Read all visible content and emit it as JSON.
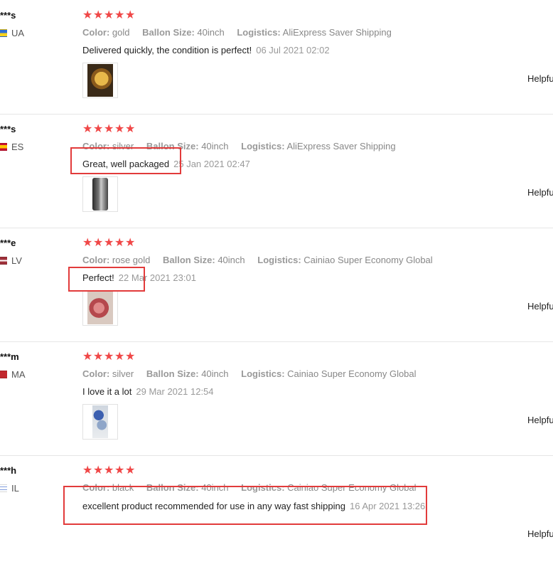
{
  "labels": {
    "color": "Color:",
    "balloon_size": "Ballon Size:",
    "logistics": "Logistics:",
    "helpful": "Helpfu"
  },
  "rating_star": "★",
  "colors": {
    "star": "#f04747",
    "highlight_box": "#e23b3b"
  },
  "reviews": [
    {
      "user": "***s",
      "country": "UA",
      "flag": [
        "#2f6fd6",
        "#f7d21c"
      ],
      "rating": 5,
      "color": "gold",
      "size": "40inch",
      "logistics": "AliExpress Saver Shipping",
      "comment": "Delivered quickly, the condition is perfect!",
      "date": "06 Jul 2021 02:02",
      "photo_icon": "photo-gold-balloon-icon"
    },
    {
      "user": "***s",
      "country": "ES",
      "flag": [
        "#c8102e",
        "#ffc400",
        "#c8102e"
      ],
      "rating": 5,
      "color": "silver",
      "size": "40inch",
      "logistics": "AliExpress Saver Shipping",
      "comment": "Great, well packaged",
      "date": "25 Jan 2021 02:47",
      "photo_icon": "photo-silver-balloon-icon"
    },
    {
      "user": "***e",
      "country": "LV",
      "flag": [
        "#9e3039",
        "#ffffff",
        "#9e3039"
      ],
      "rating": 5,
      "color": "rose gold",
      "size": "40inch",
      "logistics": "Cainiao Super Economy Global",
      "comment": "Perfect!",
      "date": "22 Mar 2021 23:01",
      "photo_icon": "photo-rose-gold-balloon-icon"
    },
    {
      "user": "***m",
      "country": "MA",
      "flag": [
        "#c1272d",
        "#c1272d"
      ],
      "rating": 5,
      "color": "silver",
      "size": "40inch",
      "logistics": "Cainiao Super Economy Global",
      "comment": "I love it a lot",
      "date": "29 Mar 2021 12:54",
      "photo_icon": "photo-balloon-bouquet-icon"
    },
    {
      "user": "***h",
      "country": "IL",
      "flag": [
        "#ffffff",
        "#0038b8",
        "#ffffff"
      ],
      "rating": 5,
      "color": "black",
      "size": "40inch",
      "logistics": "Cainiao Super Economy Global",
      "comment": "excellent product recommended for use in any way fast shipping",
      "date": "16 Apr 2021 13:26",
      "photo_icon": ""
    }
  ]
}
